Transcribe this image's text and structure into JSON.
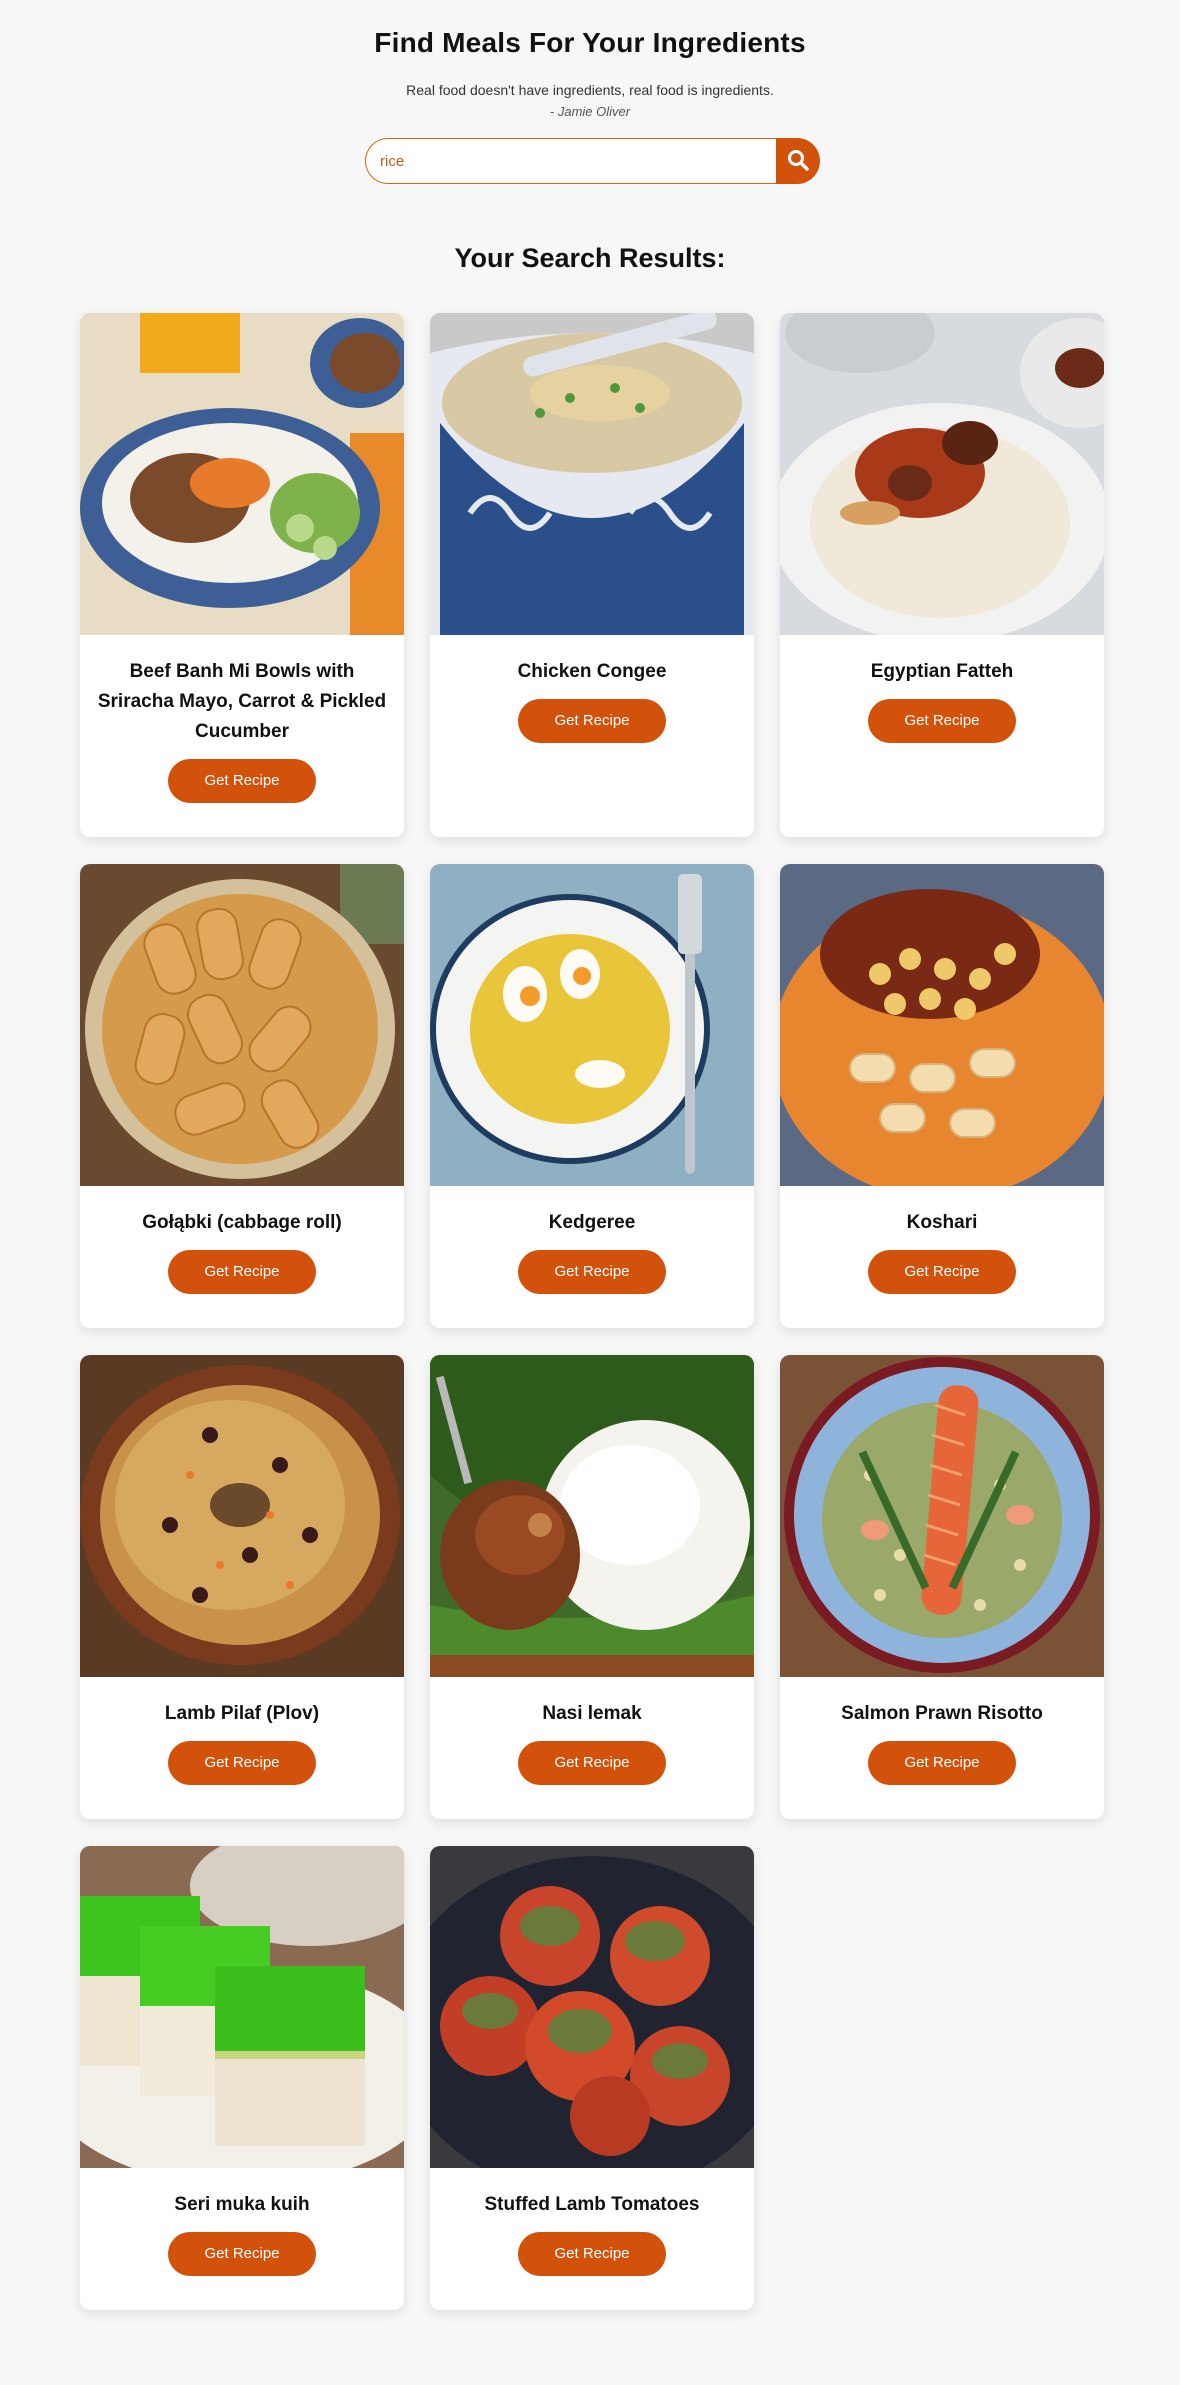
{
  "header": {
    "title": "Find Meals For Your Ingredients",
    "quote": "Real food doesn't have ingredients, real food is ingredients.",
    "quote_author": "- Jamie Oliver"
  },
  "search": {
    "value": "rice",
    "button_icon": "search-icon"
  },
  "results": {
    "heading": "Your Search Results:",
    "button_label": "Get Recipe",
    "items": [
      {
        "title": "Beef Banh Mi Bowls with Sriracha Mayo, Carrot & Pickled Cucumber"
      },
      {
        "title": "Chicken Congee"
      },
      {
        "title": "Egyptian Fatteh"
      },
      {
        "title": "Gołąbki (cabbage roll)"
      },
      {
        "title": "Kedgeree"
      },
      {
        "title": "Koshari"
      },
      {
        "title": "Lamb Pilaf (Plov)"
      },
      {
        "title": "Nasi lemak"
      },
      {
        "title": "Salmon Prawn Risotto"
      },
      {
        "title": "Seri muka kuih"
      },
      {
        "title": "Stuffed Lamb Tomatoes"
      }
    ]
  },
  "colors": {
    "accent": "#d2520c",
    "background": "#f7f7f7"
  }
}
